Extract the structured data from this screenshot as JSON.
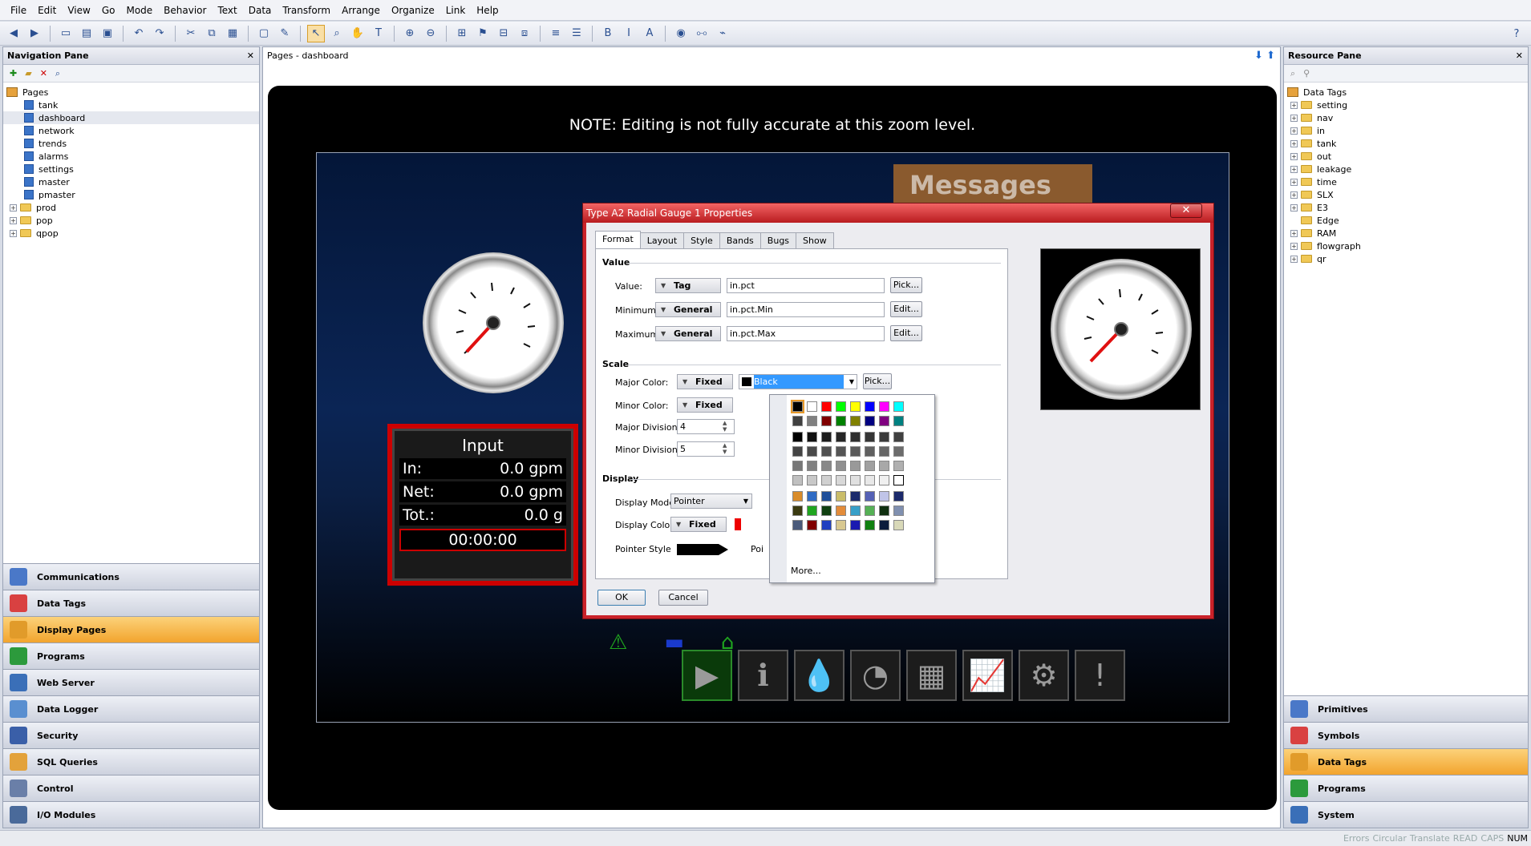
{
  "menu": [
    "File",
    "Edit",
    "View",
    "Go",
    "Mode",
    "Behavior",
    "Text",
    "Data",
    "Transform",
    "Arrange",
    "Organize",
    "Link",
    "Help"
  ],
  "nav_pane": {
    "title": "Navigation Pane",
    "root": "Pages",
    "pages": [
      "tank",
      "dashboard",
      "network",
      "trends",
      "alarms",
      "settings",
      "master",
      "pmaster"
    ],
    "folders": [
      "prod",
      "pop",
      "qpop"
    ],
    "selected": "dashboard",
    "sections": [
      "Communications",
      "Data Tags",
      "Display Pages",
      "Programs",
      "Web Server",
      "Data Logger",
      "Security",
      "SQL Queries",
      "Control",
      "I/O Modules"
    ],
    "active_section": "Display Pages"
  },
  "center": {
    "title": "Pages - dashboard",
    "note": "NOTE: Editing is not fully accurate at this zoom level.",
    "messages_label": "Messages",
    "input_panel": {
      "title": "Input",
      "rows": [
        {
          "label": "In:",
          "value": "0.0 gpm"
        },
        {
          "label": "Net:",
          "value": "0.0 gpm"
        },
        {
          "label": "Tot.:",
          "value": "0.0 g"
        }
      ],
      "timer": "00:00:00"
    }
  },
  "resource_pane": {
    "title": "Resource Pane",
    "root": "Data Tags",
    "items": [
      "setting",
      "nav",
      "in",
      "tank",
      "out",
      "leakage",
      "time",
      "SLX",
      "E3",
      "Edge",
      "RAM",
      "flowgraph",
      "qr"
    ],
    "no_expander": [
      "Edge"
    ],
    "sections": [
      "Primitives",
      "Symbols",
      "Data Tags",
      "Programs",
      "System"
    ],
    "active_section": "Data Tags"
  },
  "dialog": {
    "title": "Type A2 Radial Gauge 1 Properties",
    "tabs": [
      "Format",
      "Layout",
      "Style",
      "Bands",
      "Bugs",
      "Show"
    ],
    "active_tab": "Format",
    "value_group": "Value",
    "value_label": "Value:",
    "value_mode": "Tag",
    "value_field": "in.pct",
    "pick_label": "Pick...",
    "min_label": "Minimum:",
    "min_mode": "General",
    "min_field": "in.pct.Min",
    "edit_label": "Edit...",
    "max_label": "Maximum:",
    "max_mode": "General",
    "max_field": "in.pct.Max",
    "scale_group": "Scale",
    "major_color_label": "Major Color:",
    "major_color_mode": "Fixed",
    "major_color_value": "Black",
    "minor_color_label": "Minor Color:",
    "minor_color_mode": "Fixed",
    "major_div_label": "Major Divisions:",
    "major_div_value": "4",
    "minor_div_label": "Minor Divisions:",
    "minor_div_value": "5",
    "display_group": "Display",
    "display_mode_label": "Display Mode:",
    "display_mode_value": "Pointer",
    "display_color_label": "Display Color:",
    "display_color_mode": "Fixed",
    "pointer_style_label": "Pointer Style:",
    "pointer_style_partial": "Poi",
    "ok_label": "OK",
    "cancel_label": "Cancel",
    "palette_more": "More...",
    "close_glyph": "✕"
  },
  "status_bar": [
    "Errors",
    "Circular",
    "Translate",
    "READ",
    "CAPS",
    "NUM"
  ],
  "colors": {
    "accent_orange": "#f2a42d",
    "dialog_border": "#c9222a",
    "selection_blue": "#3399ff"
  },
  "palette_colors": [
    [
      "#000000",
      "#ffffff",
      "#ff0000",
      "#00ff00",
      "#ffff00",
      "#0000ff",
      "#ff00ff",
      "#00ffff"
    ],
    [
      "#404040",
      "#808080",
      "#800000",
      "#008000",
      "#808000",
      "#000080",
      "#800080",
      "#008080"
    ],
    [
      "#000000",
      "#111111",
      "#1c1c1c",
      "#262626",
      "#2e2e2e",
      "#353535",
      "#3a3a3a",
      "#404040"
    ],
    [
      "#444444",
      "#4a4a4a",
      "#505050",
      "#555555",
      "#5a5a5a",
      "#606060",
      "#666666",
      "#6c6c6c"
    ],
    [
      "#777777",
      "#808080",
      "#888888",
      "#909090",
      "#999999",
      "#a0a0a0",
      "#a8a8a8",
      "#b0b0b0"
    ],
    [
      "#c0c0c0",
      "#c8c8c8",
      "#d0d0d0",
      "#d8d8d8",
      "#e0e0e0",
      "#e8e8e8",
      "#f0f0f0",
      "#ffffff"
    ],
    [
      "#d98c2b",
      "#2f6bc4",
      "#1f4f9a",
      "#cabd6a",
      "#1b2a6b",
      "#5561b5",
      "#c0c4e8",
      "#1b2a6b"
    ],
    [
      "#3a3a10",
      "#1fa51f",
      "#104010",
      "#e38c3a",
      "#38a0c8",
      "#55b055",
      "#103010",
      "#8090b0"
    ],
    [
      "#4a5a7a",
      "#800000",
      "#2040c0",
      "#d8c890",
      "#1a1ab0",
      "#108010",
      "#0b1b3b",
      "#d8d8b8"
    ]
  ]
}
